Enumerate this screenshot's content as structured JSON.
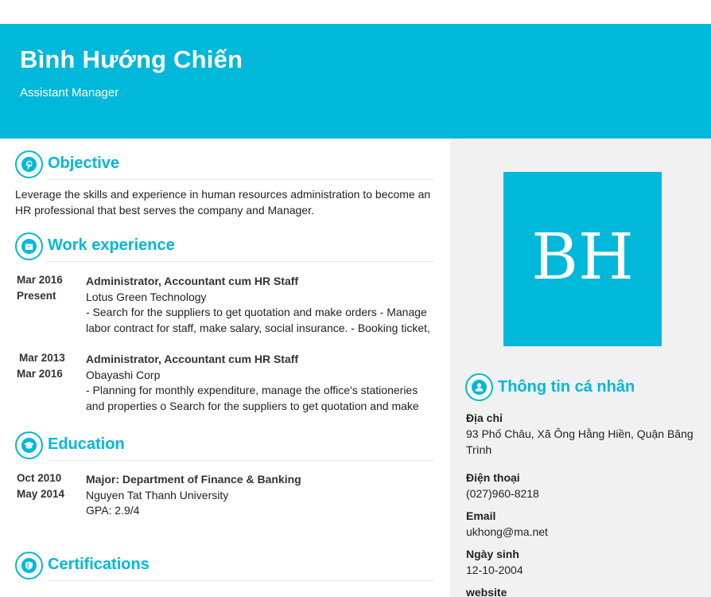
{
  "header": {
    "name": "Bình Hướng Chiến",
    "role": "Assistant Manager"
  },
  "sections": {
    "objective": {
      "title": "Objective",
      "icon": "pinterest-icon",
      "text": "Leverage the skills and experience in human resources administration to become an HR professional that best serves the company and Manager."
    },
    "work": {
      "title": "Work experience",
      "icon": "briefcase-icon",
      "items": [
        {
          "date_from": "Mar 2016",
          "date_to": "Present",
          "job_title": "Administrator, Accountant cum HR Staff",
          "company": "Lotus Green Technology",
          "desc_line1": "- Search for the suppliers to get quotation and make orders - Manage",
          "desc_line2": "labor contract for staff, make salary, social insurance. - Booking ticket,"
        },
        {
          "date_from": "Mar 2013",
          "date_to": "Mar 2016",
          "job_title": "Administrator, Accountant cum HR Staff",
          "company": "Obayashi Corp",
          "desc_line1": "- Planning for monthly expenditure, manage the office's stationeries",
          "desc_line2": "and properties o Search for the suppliers to get quotation and make"
        }
      ]
    },
    "education": {
      "title": "Education",
      "icon": "graduation-cap-icon",
      "items": [
        {
          "date_from": "Oct 2010",
          "date_to": "May 2014",
          "major": "Major: Department of Finance & Banking",
          "school": "Nguyen Tat Thanh University",
          "gpa": "GPA: 2.9/4"
        }
      ]
    },
    "certifications": {
      "title": "Certifications",
      "icon": "shield-icon"
    }
  },
  "sidebar": {
    "initials": "BH",
    "title": "Thông tin cá nhân",
    "icon": "user-icon",
    "address_label": "Địa chỉ",
    "address_line1": "93 Phố Châu, Xã Ông Hằng Hiền, Quận Băng",
    "address_line2": "Trình",
    "phone_label": "Điện thoại",
    "phone": "(027)960-8218",
    "email_label": "Email",
    "email": "ukhong@ma.net",
    "dob_label": "Ngày sinh",
    "dob": "12-10-2004",
    "website_label": "website"
  },
  "colors": {
    "accent": "#00b8d9",
    "sidebar_bg": "#f1f1f1"
  }
}
